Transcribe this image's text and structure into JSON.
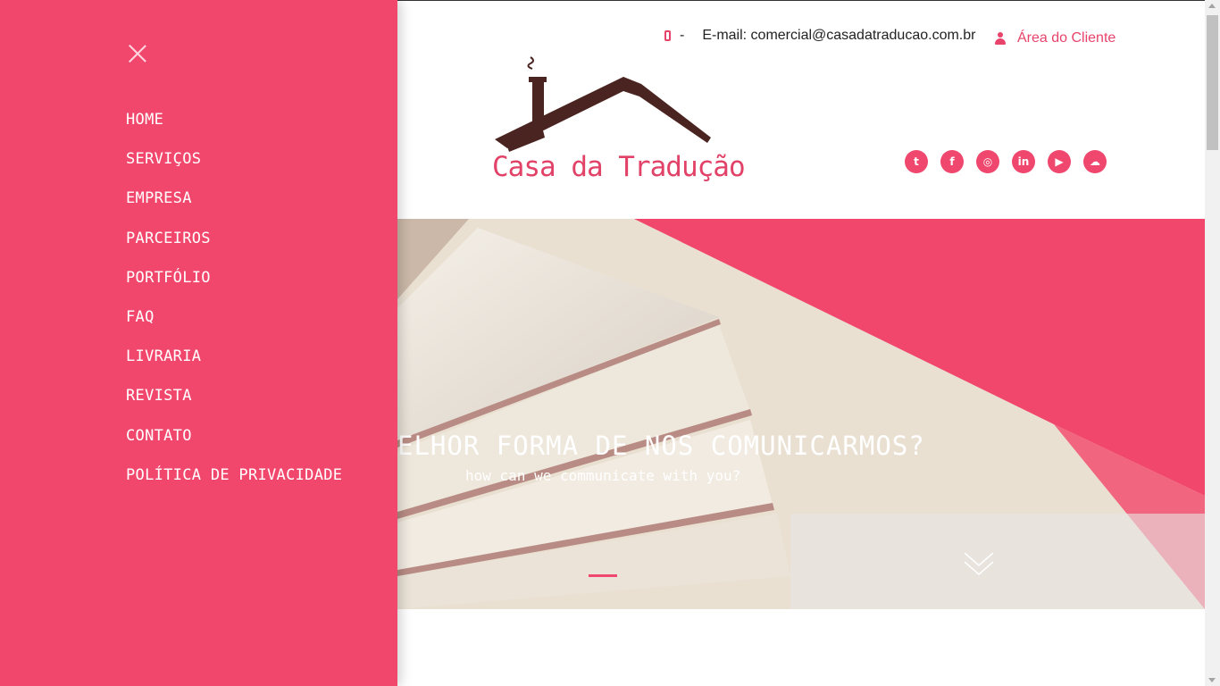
{
  "header": {
    "phone_separator": "-",
    "email_text": "E-mail: comercial@casadatraducao.com.br",
    "client_area_label": "Área do Cliente",
    "logo_text": "Casa da Tradução",
    "socials": [
      {
        "name": "twitter-icon",
        "glyph": "t"
      },
      {
        "name": "facebook-icon",
        "glyph": "f"
      },
      {
        "name": "instagram-icon",
        "glyph": "◎"
      },
      {
        "name": "linkedin-icon",
        "glyph": "in"
      },
      {
        "name": "youtube-icon",
        "glyph": "▶"
      },
      {
        "name": "soundcloud-icon",
        "glyph": "☁"
      }
    ]
  },
  "hero": {
    "title": "ELHOR FORMA DE NOS COMUNICARMOS?",
    "subtitle": "how can we communicate with you?"
  },
  "menu": {
    "items": [
      "HOME",
      "SERVIÇOS",
      "EMPRESA",
      "PARCEIROS",
      "PORTFÓLIO",
      "FAQ",
      "LIVRARIA",
      "REVISTA",
      "CONTATO",
      "POLÍTICA DE PRIVACIDADE"
    ]
  },
  "colors": {
    "accent": "#f2476c",
    "logo_brown": "#4a2420"
  }
}
